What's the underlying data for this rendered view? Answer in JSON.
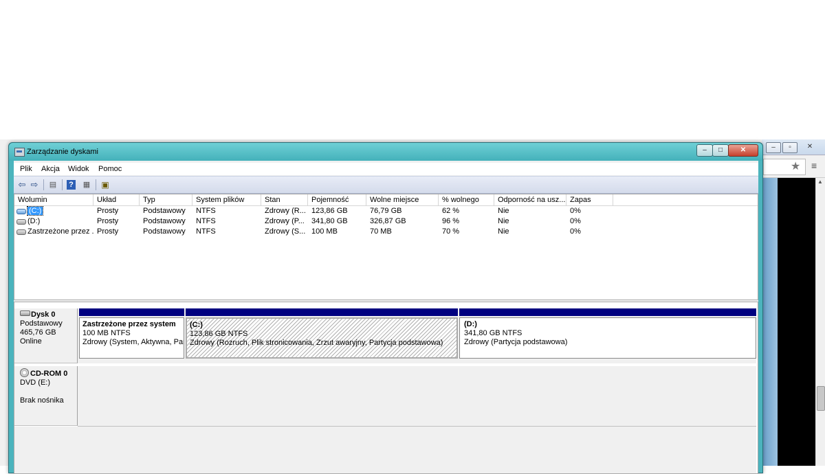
{
  "window": {
    "title": "Zarządzanie dyskami",
    "controls": {
      "minimize": "–",
      "maximize": "□",
      "close": "✕"
    }
  },
  "menu": [
    "Plik",
    "Akcja",
    "Widok",
    "Pomoc"
  ],
  "toolbar": {
    "back_icon": "back-arrow-icon",
    "forward_icon": "forward-arrow-icon",
    "show_hide_icon": "console-tree-icon",
    "help_icon": "help-icon",
    "properties_icon": "properties-icon",
    "settings_icon": "disk-settings-icon"
  },
  "volumes": {
    "columns": [
      "Wolumin",
      "Układ",
      "Typ",
      "System plików",
      "Stan",
      "Pojemność",
      "Wolne miejsce",
      "% wolnego",
      "Odporność na usz...",
      "Zapas"
    ],
    "rows": [
      {
        "name": "(C:)",
        "layout": "Prosty",
        "type": "Podstawowy",
        "fs": "NTFS",
        "status": "Zdrowy (R...",
        "capacity": "123,86 GB",
        "free": "76,79 GB",
        "pct_free": "62 %",
        "fault": "Nie",
        "overhead": "0%"
      },
      {
        "name": "(D:)",
        "layout": "Prosty",
        "type": "Podstawowy",
        "fs": "NTFS",
        "status": "Zdrowy (P...",
        "capacity": "341,80 GB",
        "free": "326,87 GB",
        "pct_free": "96 %",
        "fault": "Nie",
        "overhead": "0%"
      },
      {
        "name": "Zastrzeżone przez ...",
        "layout": "Prosty",
        "type": "Podstawowy",
        "fs": "NTFS",
        "status": "Zdrowy (S...",
        "capacity": "100 MB",
        "free": "70 MB",
        "pct_free": "70 %",
        "fault": "Nie",
        "overhead": "0%"
      }
    ]
  },
  "disks": [
    {
      "name": "Dysk 0",
      "type": "Podstawowy",
      "size": "465,76 GB",
      "status": "Online",
      "partitions": [
        {
          "title": "Zastrzeżone przez system",
          "size": "100 MB NTFS",
          "status": "Zdrowy (System, Aktywna, Par"
        },
        {
          "title": "(C:)",
          "size": "123,86 GB NTFS",
          "status": "Zdrowy (Rozruch, Plik stronicowania, Zrzut awaryjny, Partycja podstawowa)"
        },
        {
          "title": "(D:)",
          "size": "341,80 GB NTFS",
          "status": "Zdrowy (Partycja podstawowa)"
        }
      ]
    },
    {
      "name": "CD-ROM 0",
      "type": "DVD (E:)",
      "status": "Brak nośnika"
    }
  ],
  "background_browser": {
    "controls": {
      "minimize": "–",
      "maximize": "▫",
      "close": "✕"
    },
    "star_icon": "★",
    "menu_icon": "≡"
  }
}
